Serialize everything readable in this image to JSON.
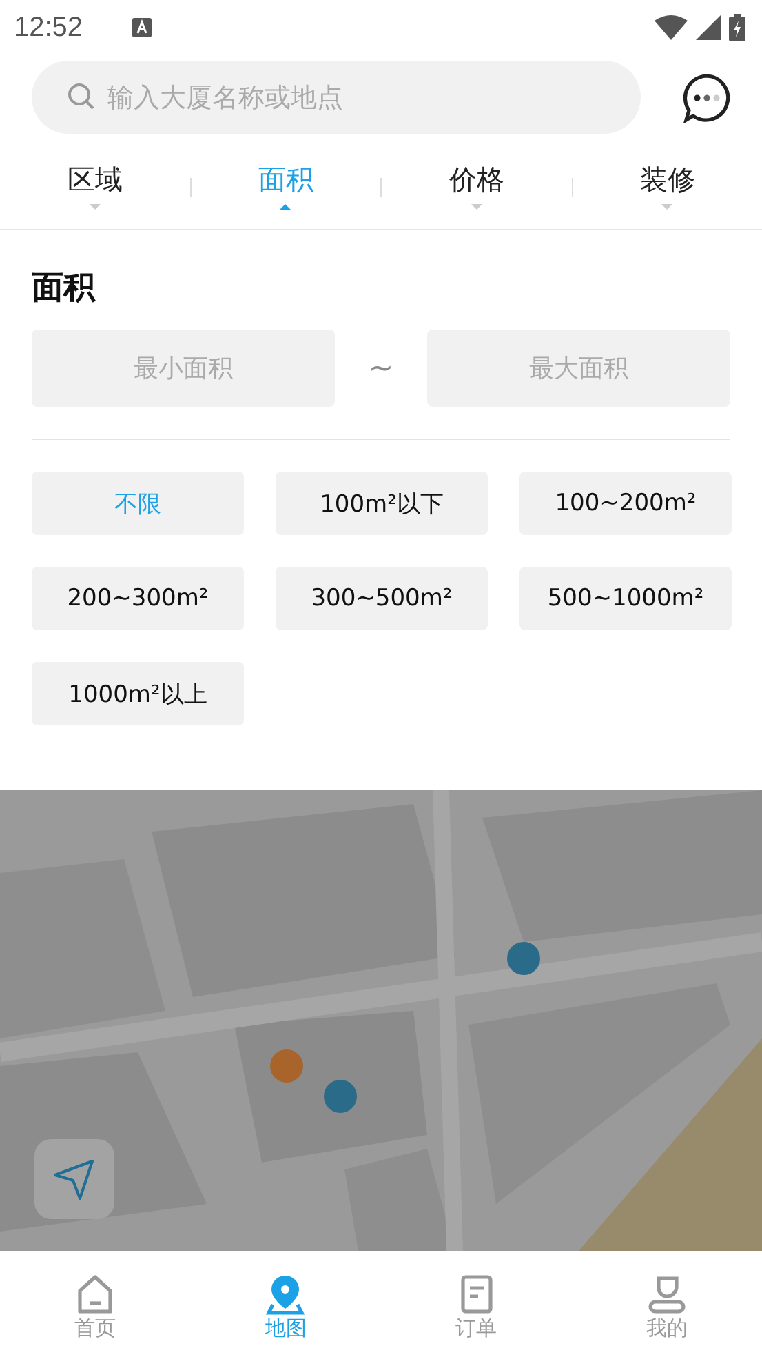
{
  "status_bar": {
    "time": "12:52"
  },
  "search": {
    "placeholder": "输入大厦名称或地点"
  },
  "filter_tabs": [
    {
      "label": "区域",
      "selected": false
    },
    {
      "label": "面积",
      "selected": true
    },
    {
      "label": "价格",
      "selected": false
    },
    {
      "label": "装修",
      "selected": false
    }
  ],
  "area_panel": {
    "title": "面积",
    "min": {
      "placeholder": "最小面积"
    },
    "separator": "~",
    "max": {
      "placeholder": "最大面积"
    },
    "options": [
      {
        "label": "不限",
        "selected": true
      },
      {
        "label": "100m²以下",
        "selected": false
      },
      {
        "label": "100~200m²",
        "selected": false
      },
      {
        "label": "200~300m²",
        "selected": false
      },
      {
        "label": "300~500m²",
        "selected": false
      },
      {
        "label": "500~1000m²",
        "selected": false
      },
      {
        "label": "1000m²以上",
        "selected": false
      }
    ]
  },
  "bottom_nav": [
    {
      "label": "首页",
      "kind": "home",
      "selected": false
    },
    {
      "label": "地图",
      "kind": "map",
      "selected": true
    },
    {
      "label": "订单",
      "kind": "order",
      "selected": false
    },
    {
      "label": "我的",
      "kind": "user",
      "selected": false
    }
  ]
}
